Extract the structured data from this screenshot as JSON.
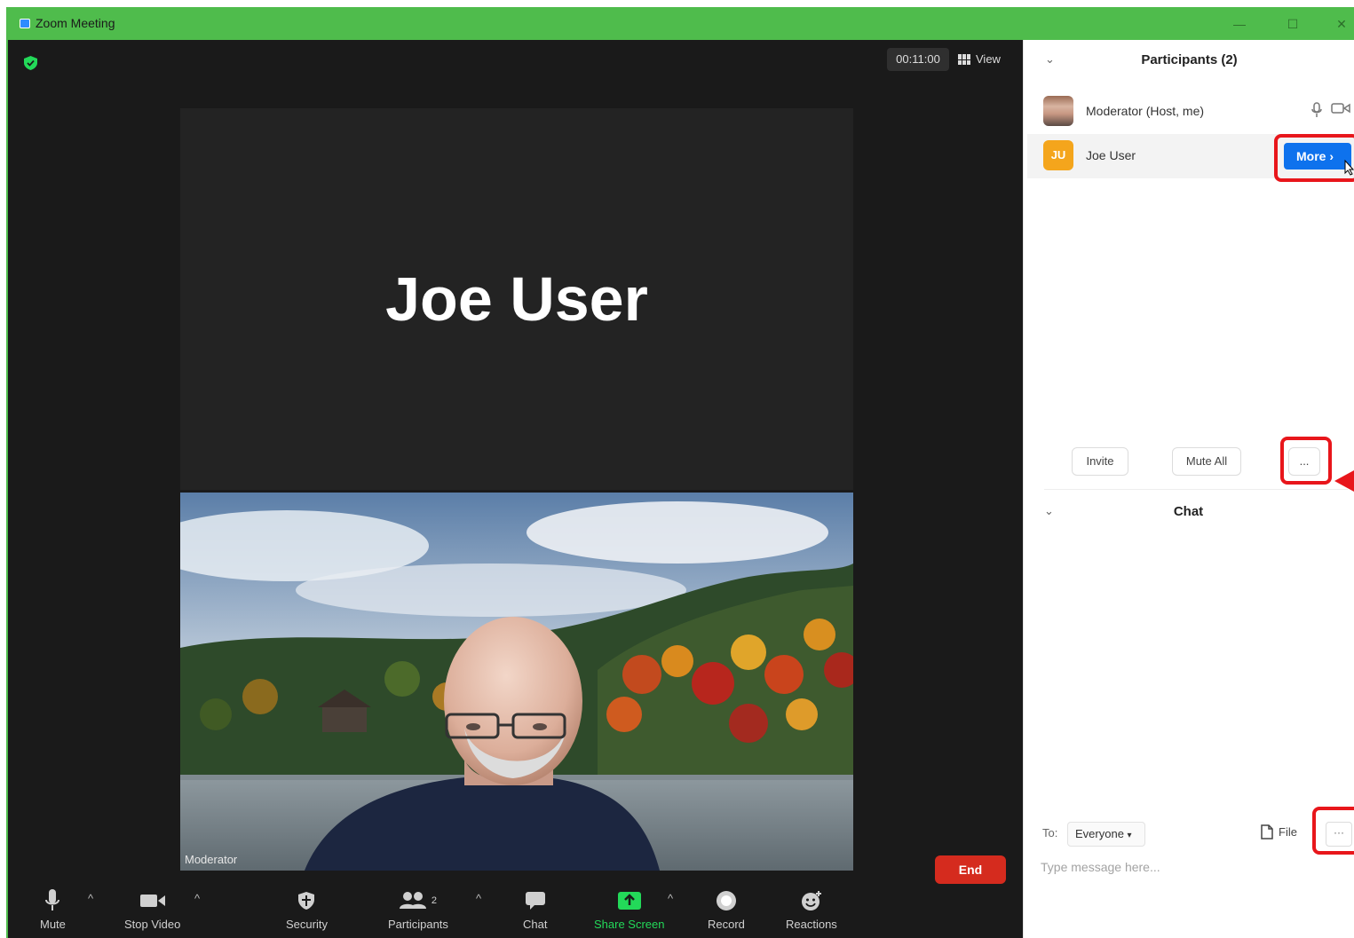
{
  "window": {
    "title": "Zoom Meeting"
  },
  "meeting": {
    "timer": "00:11:00",
    "view_label": "View",
    "main_tile_name": "Joe User",
    "self_tile_label": "Moderator"
  },
  "toolbar": {
    "mute": "Mute",
    "stop_video": "Stop Video",
    "security": "Security",
    "participants": "Participants",
    "participants_count": "2",
    "chat": "Chat",
    "share_screen": "Share Screen",
    "record": "Record",
    "reactions": "Reactions",
    "end": "End"
  },
  "participants_panel": {
    "title": "Participants (2)",
    "participants": [
      {
        "name": "Moderator (Host, me)",
        "avatar": "photo"
      },
      {
        "name": "Joe User",
        "initials": "JU"
      }
    ],
    "more_button": "More",
    "invite": "Invite",
    "mute_all": "Mute All",
    "more_options": "..."
  },
  "chat_panel": {
    "title": "Chat",
    "to_label": "To:",
    "recipient": "Everyone",
    "file_label": "File",
    "more_options": "···",
    "input_placeholder": "Type message here..."
  },
  "colors": {
    "titlebar": "#4fbc4c",
    "meeting_bg": "#1a1a1a",
    "end_button": "#d52b1e",
    "more_button": "#0e72ed",
    "share_green": "#23d959",
    "annotation_red": "#e8161b"
  }
}
